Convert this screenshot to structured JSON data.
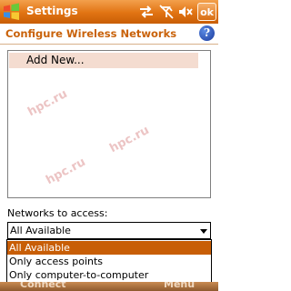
{
  "titlebar": {
    "title": "Settings",
    "ok_label": "ok",
    "icons": [
      "windows-start-icon",
      "connectivity-arrows-icon",
      "signal-off-icon",
      "speaker-muted-icon"
    ]
  },
  "header": {
    "title": "Configure Wireless Networks",
    "help_icon": "question-help-icon"
  },
  "network_list": {
    "items": [
      {
        "label": "Add New..."
      }
    ],
    "watermark": "hpc.ru"
  },
  "access": {
    "label": "Networks to access:",
    "selected_value": "All Available",
    "options": [
      "All Available",
      "Only access points",
      "Only computer-to-computer"
    ],
    "selected_index": 0
  },
  "softkeys": {
    "left": "Connect",
    "right": "Menu"
  },
  "colors": {
    "accent": "#c85e06",
    "title_orange": "#e17312",
    "header_text": "#c9620a",
    "list_highlight": "#f4dcd0"
  }
}
